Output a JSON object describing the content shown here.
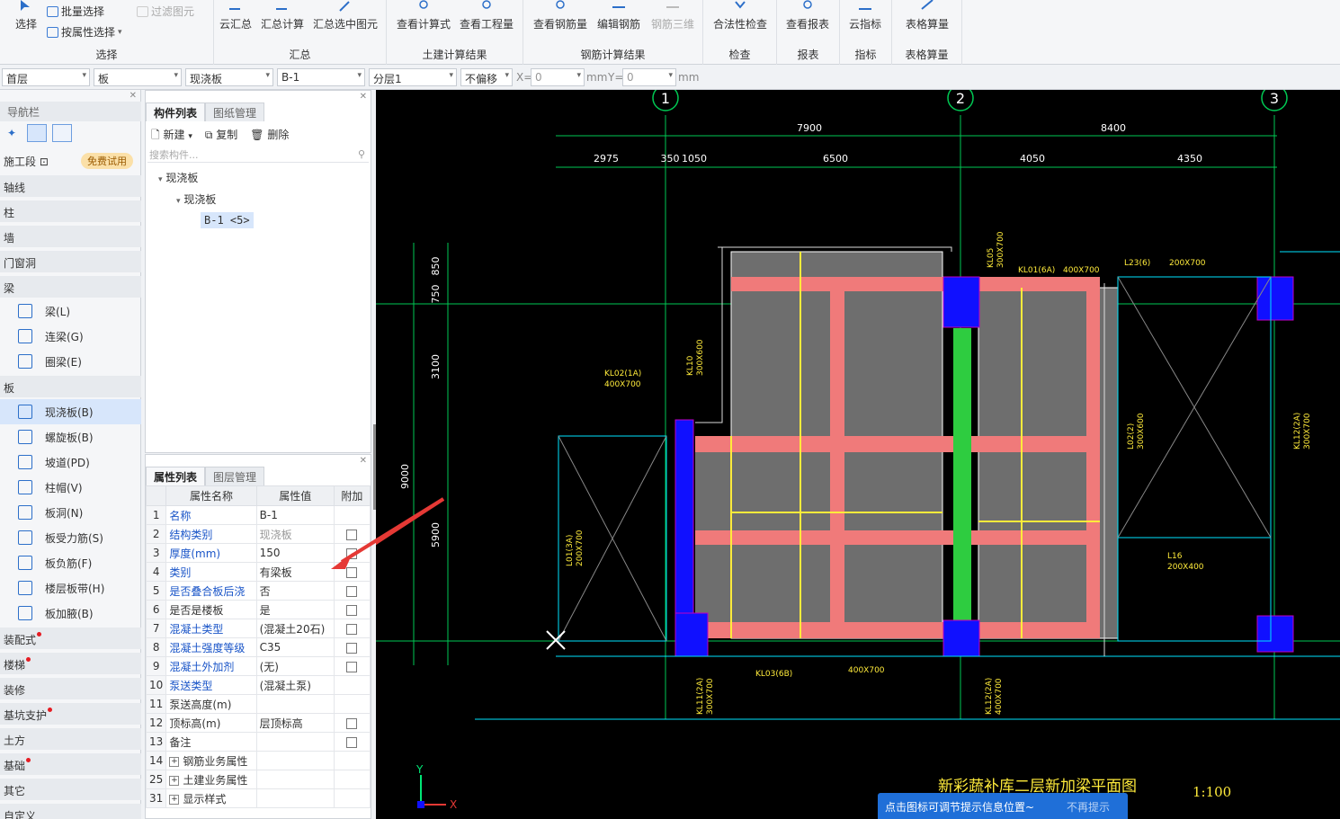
{
  "ribbon": {
    "select_group": {
      "select": "选择",
      "batch_select": "批量选择",
      "filter": "过滤图元",
      "by_attr": "按属性选择",
      "title": "选择"
    },
    "summary_group": {
      "cloud_sum": "云汇总",
      "sum_calc": "汇总计算",
      "sum_selected": "汇总选中图元",
      "title": "汇总"
    },
    "civil_group": {
      "view_formula": "查看计算式",
      "view_quantity": "查看工程量",
      "title": "土建计算结果"
    },
    "rebar_group": {
      "view_rebar_qty": "查看钢筋量",
      "edit_rebar": "编辑钢筋",
      "rebar_3d": "钢筋三维",
      "title": "钢筋计算结果"
    },
    "check_group": {
      "legality": "合法性检查",
      "title": "检查"
    },
    "report_group": {
      "view_report": "查看报表",
      "title": "报表"
    },
    "index_group": {
      "cloud_index": "云指标",
      "title": "指标"
    },
    "table_group": {
      "table_calc": "表格算量",
      "title": "表格算量"
    }
  },
  "toolbar2": {
    "floor": "首层",
    "type": "板",
    "subtype": "现浇板",
    "component": "B-1",
    "layer": "分层1",
    "offset": "不偏移",
    "x_label": "X=",
    "x_value": "0",
    "unit1": "mm",
    "y_label": "Y=",
    "y_value": "0",
    "unit2": "mm"
  },
  "nav": {
    "header": "导航栏",
    "construction_segment": "施工段",
    "trial_badge": "免费试用",
    "categories": {
      "axis": "轴线",
      "column": "柱",
      "wall": "墙",
      "door_window": "门窗洞",
      "beam": "梁",
      "slab": "板",
      "prefab": "装配式",
      "stair": "楼梯",
      "decor": "装修",
      "pit": "基坑支护",
      "earth": "土方",
      "foundation": "基础",
      "other": "其它",
      "custom": "自定义"
    },
    "beam_items": [
      "梁(L)",
      "连梁(G)",
      "圈梁(E)"
    ],
    "slab_items": [
      "现浇板(B)",
      "螺旋板(B)",
      "坡道(PD)",
      "柱帽(V)",
      "板洞(N)",
      "板受力筋(S)",
      "板负筋(F)",
      "楼层板带(H)",
      "板加腋(B)"
    ]
  },
  "comp_panel": {
    "tab_components": "构件列表",
    "tab_drawings": "图纸管理",
    "new": "新建",
    "copy": "复制",
    "delete": "删除",
    "search_placeholder": "搜索构件...",
    "tree_root": "现浇板",
    "tree_child": "现浇板",
    "tree_leaf": "B-1 <5>"
  },
  "prop_panel": {
    "tab_props": "属性列表",
    "tab_layers": "图层管理",
    "col_name": "属性名称",
    "col_value": "属性值",
    "col_extra": "附加",
    "rows": [
      {
        "n": "1",
        "name": "名称",
        "value": "B-1"
      },
      {
        "n": "2",
        "name": "结构类别",
        "value": "现浇板"
      },
      {
        "n": "3",
        "name": "厚度(mm)",
        "value": "150"
      },
      {
        "n": "4",
        "name": "类别",
        "value": "有梁板"
      },
      {
        "n": "5",
        "name": "是否叠合板后浇",
        "value": "否"
      },
      {
        "n": "6",
        "name": "是否是楼板",
        "value": "是"
      },
      {
        "n": "7",
        "name": "混凝土类型",
        "value": "(混凝土20石)"
      },
      {
        "n": "8",
        "name": "混凝土强度等级",
        "value": "C35"
      },
      {
        "n": "9",
        "name": "混凝土外加剂",
        "value": "(无)"
      },
      {
        "n": "10",
        "name": "泵送类型",
        "value": "(混凝土泵)"
      },
      {
        "n": "11",
        "name": "泵送高度(m)",
        "value": ""
      },
      {
        "n": "12",
        "name": "顶标高(m)",
        "value": "层顶标高"
      },
      {
        "n": "13",
        "name": "备注",
        "value": ""
      },
      {
        "n": "14",
        "name": "钢筋业务属性",
        "value": ""
      },
      {
        "n": "25",
        "name": "土建业务属性",
        "value": ""
      },
      {
        "n": "31",
        "name": "显示样式",
        "value": ""
      }
    ]
  },
  "cad": {
    "axes": [
      "1",
      "2",
      "3"
    ],
    "dims_top": [
      "7900",
      "8400"
    ],
    "dims_second": [
      "2975",
      "350",
      "1050",
      "6500",
      "4050",
      "4350"
    ],
    "dims_left": [
      "850",
      "750",
      "3100",
      "9000",
      "5900"
    ],
    "beam_labels": [
      "KL02(1A)",
      "400X700",
      "KL01(6A)",
      "400X700",
      "L23(6)",
      "200X700",
      "KL05",
      "300X700",
      "KL10",
      "300X600",
      "L02(2)",
      "300X600",
      "KL12(2A)",
      "300X700",
      "L01(3A)",
      "200X700",
      "L16",
      "200X400",
      "KL03(6B)",
      "400X700",
      "KL11(2A)",
      "300X700",
      "KL12(2A)",
      "400X700"
    ],
    "drawing_title": "新彩蔬补库二层新加梁平面图",
    "scale": "1:100",
    "ucs_x": "X",
    "ucs_y": "Y"
  },
  "hint": {
    "text": "点击图标可调节提示信息位置~",
    "dismiss": "不再提示"
  }
}
